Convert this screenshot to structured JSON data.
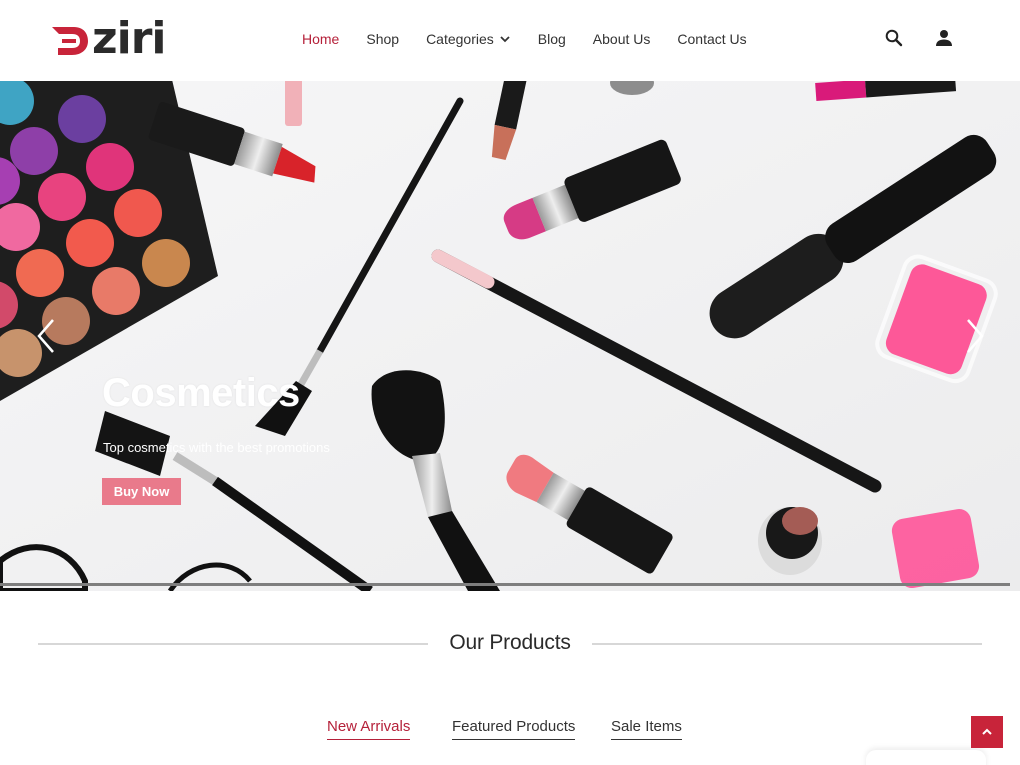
{
  "brand": {
    "name": "ziri",
    "accent": "#b5213a",
    "logo_icon": "dziri-logo-mark"
  },
  "nav": {
    "items": [
      {
        "label": "Home",
        "active": true
      },
      {
        "label": "Shop"
      },
      {
        "label": "Categories",
        "has_dropdown": true
      },
      {
        "label": "Blog"
      },
      {
        "label": "About Us"
      },
      {
        "label": "Contact Us"
      }
    ],
    "icons": [
      "search-icon",
      "user-icon"
    ]
  },
  "hero": {
    "title": "Cosmetics",
    "subtitle": "Top cosmetics with the best promotions",
    "button_label": "Buy Now",
    "button_color": "#e97a8b",
    "prev_icon": "chevron-left-icon",
    "next_icon": "chevron-right-icon"
  },
  "products": {
    "title": "Our Products",
    "tabs": [
      {
        "label": "New Arrivals",
        "active": true
      },
      {
        "label": "Featured Products"
      },
      {
        "label": "Sale Items"
      }
    ]
  },
  "scroll_top": {
    "icon": "chevron-up-icon",
    "color": "#c8243a"
  }
}
